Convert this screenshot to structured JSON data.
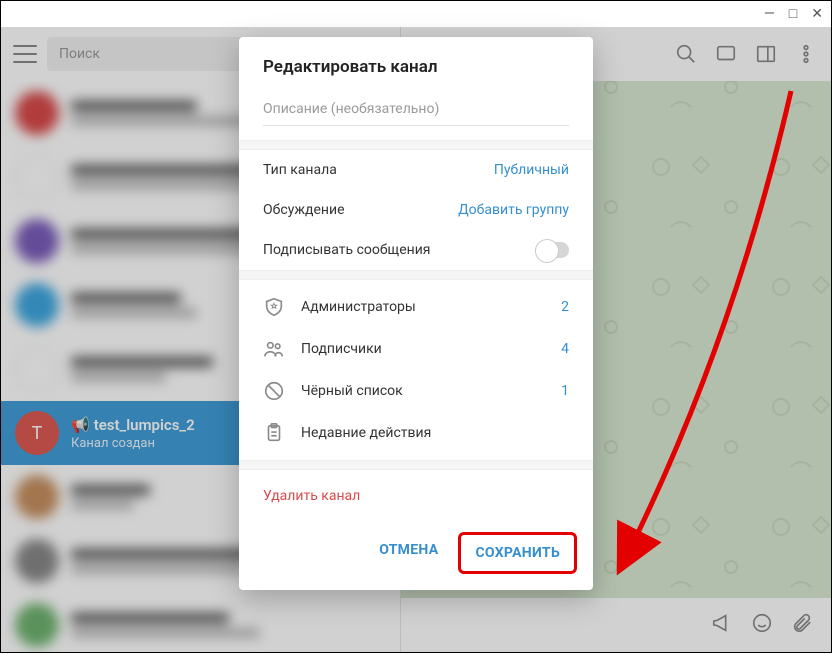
{
  "window": {
    "minimize": "—",
    "maximize": "□",
    "close": "✕"
  },
  "search": {
    "placeholder": "Поиск"
  },
  "selected_chat": {
    "avatar_letter": "T",
    "name": "test_lumpics_2",
    "subtitle": "Канал создан",
    "speaker": "📢"
  },
  "modal": {
    "title": "Редактировать канал",
    "description_placeholder": "Описание (необязательно)",
    "rows": {
      "type_label": "Тип канала",
      "type_value": "Публичный",
      "discussion_label": "Обсуждение",
      "discussion_value": "Добавить группу",
      "sign_label": "Подписывать сообщения"
    },
    "items": {
      "admins": {
        "label": "Администраторы",
        "count": "2"
      },
      "subscribers": {
        "label": "Подписчики",
        "count": "4"
      },
      "blacklist": {
        "label": "Чёрный список",
        "count": "1"
      },
      "recent": {
        "label": "Недавние действия"
      }
    },
    "delete": "Удалить канал",
    "cancel": "ОТМЕНА",
    "save": "СОХРАНИТЬ"
  }
}
